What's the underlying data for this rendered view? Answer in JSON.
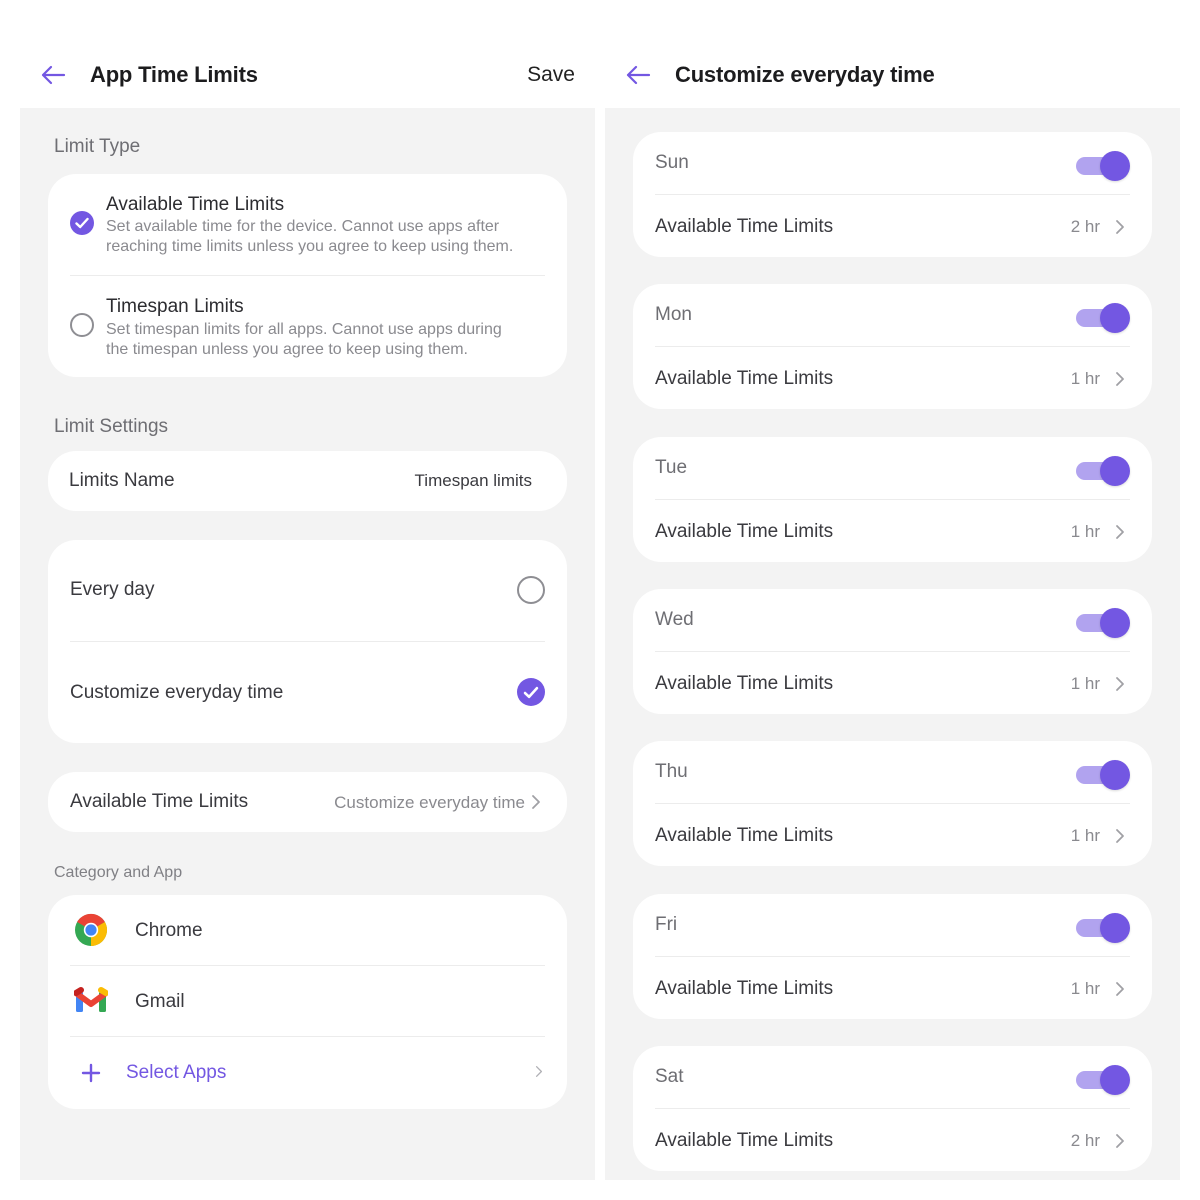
{
  "accent_color": "#7357e2",
  "left": {
    "header": {
      "title": "App Time Limits",
      "back_icon": "arrow-left-icon",
      "save_label": "Save"
    },
    "limit_type": {
      "label": "Limit Type",
      "options": [
        {
          "title": "Available Time Limits",
          "description_line1": "Set available time for the device. Cannot use apps after",
          "description_line2": "reaching time limits unless you agree to keep using them.",
          "selected": true
        },
        {
          "title": "Timespan Limits",
          "description_line1": "Set timespan limits for all apps. Cannot use apps during",
          "description_line2": "the timespan unless you agree to keep using them.",
          "selected": false
        }
      ]
    },
    "limit_settings": {
      "label": "Limit Settings",
      "limits_name_label": "Limits Name",
      "limits_name_value": "Timespan limits",
      "schedule_options": [
        {
          "label": "Every day",
          "selected": false
        },
        {
          "label": "Customize everyday time",
          "selected": true
        }
      ],
      "available_time_label": "Available Time Limits",
      "available_time_value": "Customize everyday time"
    },
    "category_and_app": {
      "label": "Category and App",
      "apps": [
        {
          "name": "Chrome",
          "icon": "chrome-icon"
        },
        {
          "name": "Gmail",
          "icon": "gmail-icon"
        }
      ],
      "select_apps_label": "Select Apps"
    }
  },
  "right": {
    "header": {
      "title": "Customize everyday time",
      "back_icon": "arrow-left-icon"
    },
    "days": [
      {
        "day": "Sun",
        "enabled": true,
        "limit_label": "Available Time Limits",
        "limit_value": "2 hr"
      },
      {
        "day": "Mon",
        "enabled": true,
        "limit_label": "Available Time Limits",
        "limit_value": "1 hr"
      },
      {
        "day": "Tue",
        "enabled": true,
        "limit_label": "Available Time Limits",
        "limit_value": "1 hr"
      },
      {
        "day": "Wed",
        "enabled": true,
        "limit_label": "Available Time Limits",
        "limit_value": "1 hr"
      },
      {
        "day": "Thu",
        "enabled": true,
        "limit_label": "Available Time Limits",
        "limit_value": "1 hr"
      },
      {
        "day": "Fri",
        "enabled": true,
        "limit_label": "Available Time Limits",
        "limit_value": "1 hr"
      },
      {
        "day": "Sat",
        "enabled": true,
        "limit_label": "Available Time Limits",
        "limit_value": "2 hr"
      }
    ]
  }
}
